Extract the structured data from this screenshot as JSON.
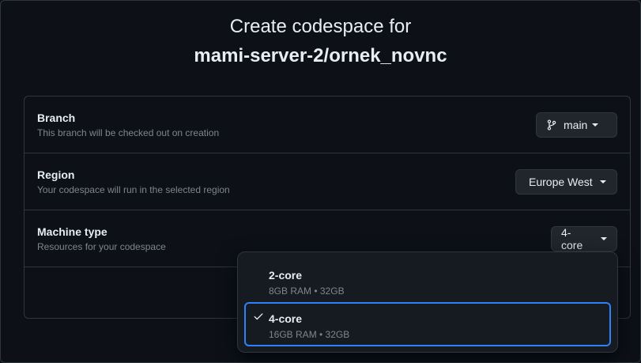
{
  "title": {
    "line1": "Create codespace for",
    "repo": "mami-server-2/ornek_novnc"
  },
  "settings": [
    {
      "label": "Branch",
      "description": "This branch will be checked out on creation",
      "value": "main",
      "icon": "git-branch-icon"
    },
    {
      "label": "Region",
      "description": "Your codespace will run in the selected region",
      "value": "Europe West"
    },
    {
      "label": "Machine type",
      "description": "Resources for your codespace",
      "value": "4-core"
    }
  ],
  "machine_options": [
    {
      "name": "2-core",
      "spec": "8GB RAM • 32GB",
      "selected": false
    },
    {
      "name": "4-core",
      "spec": "16GB RAM • 32GB",
      "selected": true
    }
  ],
  "colors": {
    "background": "#0d1117",
    "border": "#30363d",
    "button": "#21262d",
    "accent": "#2f81f7",
    "muted": "#7d8590"
  }
}
